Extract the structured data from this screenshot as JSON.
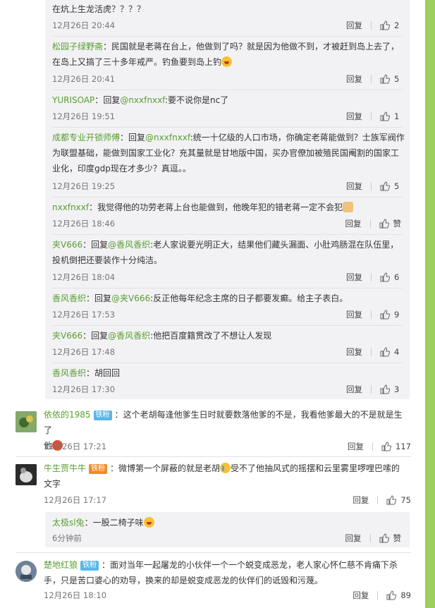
{
  "actions": {
    "reply": "回复",
    "like_text": "赞"
  },
  "colors": {
    "accent_green": "#5a9e2f",
    "reply_bg": "#f2f2f5",
    "rail": "#9ccf5c",
    "badge": "#5bb6e8"
  },
  "sub_replies": [
    {
      "line1": "在炕上生龙活虎？？？？",
      "time": "12月26日 20:44",
      "likes": "2"
    },
    {
      "author": "松园子绿野斋",
      "sep": "：",
      "line1": "民国就是老蒋在台上，他做到了吗？就是因为他做不到，才被赶到岛上去了，",
      "line2": "在岛上又搞了三十多年戒严。钓鱼要到岛上钓",
      "time": "12月26日 20:41",
      "likes": "5",
      "emoji": "laugh-emoji"
    },
    {
      "author": "YURISOAP",
      "sep": "：",
      "prefix": "回复",
      "mention": "@nxxfnxxf",
      "line1": ":要不说你是nc了",
      "time": "12月26日 19:51",
      "likes": "1"
    },
    {
      "author": "成都专业开锁师傅",
      "sep": "：",
      "prefix": "回复",
      "mention": "@nxxfnxxf",
      "line1": ":统一十亿级的人口市场，你确定老蒋能做到？士族军阀作",
      "line2": "为联盟基础，能做到国家工业化？充其量就是甘地版中国，买办官僚加被殖民国阉割的国家工",
      "line3": "业化，印度gdp现在才多少？真逗。。",
      "time": "12月26日 19:25",
      "likes": "5"
    },
    {
      "author": "nxxfnxxf",
      "sep": "：",
      "line1": "我觉得他的功劳老蒋上台也能做到，他晚年犯的错老蒋一定不会犯",
      "time": "12月26日 18:46",
      "likes": "赞",
      "emoji": "cat-emoji"
    },
    {
      "author": "夹V666",
      "sep": "：",
      "prefix": "回复",
      "mention": "@香风香织",
      "line1": ":老人家说要光明正大，结果他们藏头漏面、小肚鸡肠混在队伍里，",
      "line2": "投机倒把还要装作十分纯洁。",
      "time": "12月26日 18:04",
      "likes": "6"
    },
    {
      "author": "香风香织",
      "sep": "：",
      "prefix": "回复",
      "mention": "@夹V666",
      "line1": ":反正他每年纪念主席的日子都要发癫。给主子表白。",
      "time": "12月26日 17:53",
      "likes": "9"
    },
    {
      "author": "夹V666",
      "sep": "：",
      "prefix": "回复",
      "mention": "@香风香织",
      "line1": ":他把百度籍贯改了不想让人发现",
      "time": "12月26日 17:48",
      "likes": "4"
    },
    {
      "author": "香风香织",
      "sep": "：",
      "line1": "胡回回",
      "time": "12月26日 17:30",
      "likes": "3"
    }
  ],
  "comments": [
    {
      "author": "依依的1985",
      "badge": "铁粉",
      "sep": "：",
      "line1": "这个老胡每逢他爹生日时就要数落他爹的不是，我看他爹最大的不是就是生了",
      "line2": "他",
      "emoji": "angry-emoji",
      "time": "12月26日 17:21",
      "likes": "117"
    },
    {
      "author": "牛生贾牛牛",
      "badge": "铁粉",
      "sep": "：",
      "line1": "微博第一个屏蔽的就是老胡",
      "line1b": "受不了他抽风式的摇摆和云里雾里啰哩巴嗦的",
      "line2": "文字",
      "emoji": "cry-emoji",
      "time": "12月26日 17:17",
      "likes": "75",
      "reply": {
        "author": "太极sl兔",
        "sep": "：",
        "line1": "一股二椅子味",
        "emoji": "laugh-emoji",
        "time": "6分钟前",
        "likes": "赞"
      }
    },
    {
      "author": "楚地红狼",
      "badge": "铁粉",
      "sep": "：",
      "line1": "面对当年一起屠龙的小伙伴一个一个蜕变成恶龙，老人家心怀仁慈不肯痛下杀",
      "line2": "手，只是苦口婆心的劝导，换来的却是蜕变成恶龙的伙伴们的诋毁和污蔑。",
      "time": "12月26日 18:10",
      "likes": "89"
    }
  ]
}
